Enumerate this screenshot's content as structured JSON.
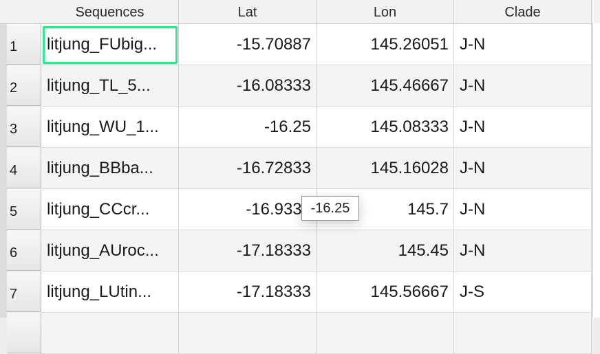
{
  "columns": {
    "sequences": "Sequences",
    "lat": "Lat",
    "lon": "Lon",
    "clade": "Clade"
  },
  "rows": [
    {
      "num": "1",
      "seq": "litjung_FUbig...",
      "lat": "-15.70887",
      "lon": "145.26051",
      "clade": "J-N"
    },
    {
      "num": "2",
      "seq": "litjung_TL_5...",
      "lat": "-16.08333",
      "lon": "145.46667",
      "clade": "J-N"
    },
    {
      "num": "3",
      "seq": "litjung_WU_1...",
      "lat": "-16.25",
      "lon": "145.08333",
      "clade": "J-N"
    },
    {
      "num": "4",
      "seq": "litjung_BBba...",
      "lat": "-16.72833",
      "lon": "145.16028",
      "clade": "J-N"
    },
    {
      "num": "5",
      "seq": "litjung_CCcr...",
      "lat": "-16.9333",
      "lon": "145.7",
      "clade": "J-N"
    },
    {
      "num": "6",
      "seq": "litjung_AUroc...",
      "lat": "-17.18333",
      "lon": "145.45",
      "clade": "J-N"
    },
    {
      "num": "7",
      "seq": "litjung_LUtin...",
      "lat": "-17.18333",
      "lon": "145.56667",
      "clade": "J-S"
    }
  ],
  "tooltip": "-16.25",
  "colors": {
    "selection": "#2ee88a"
  }
}
